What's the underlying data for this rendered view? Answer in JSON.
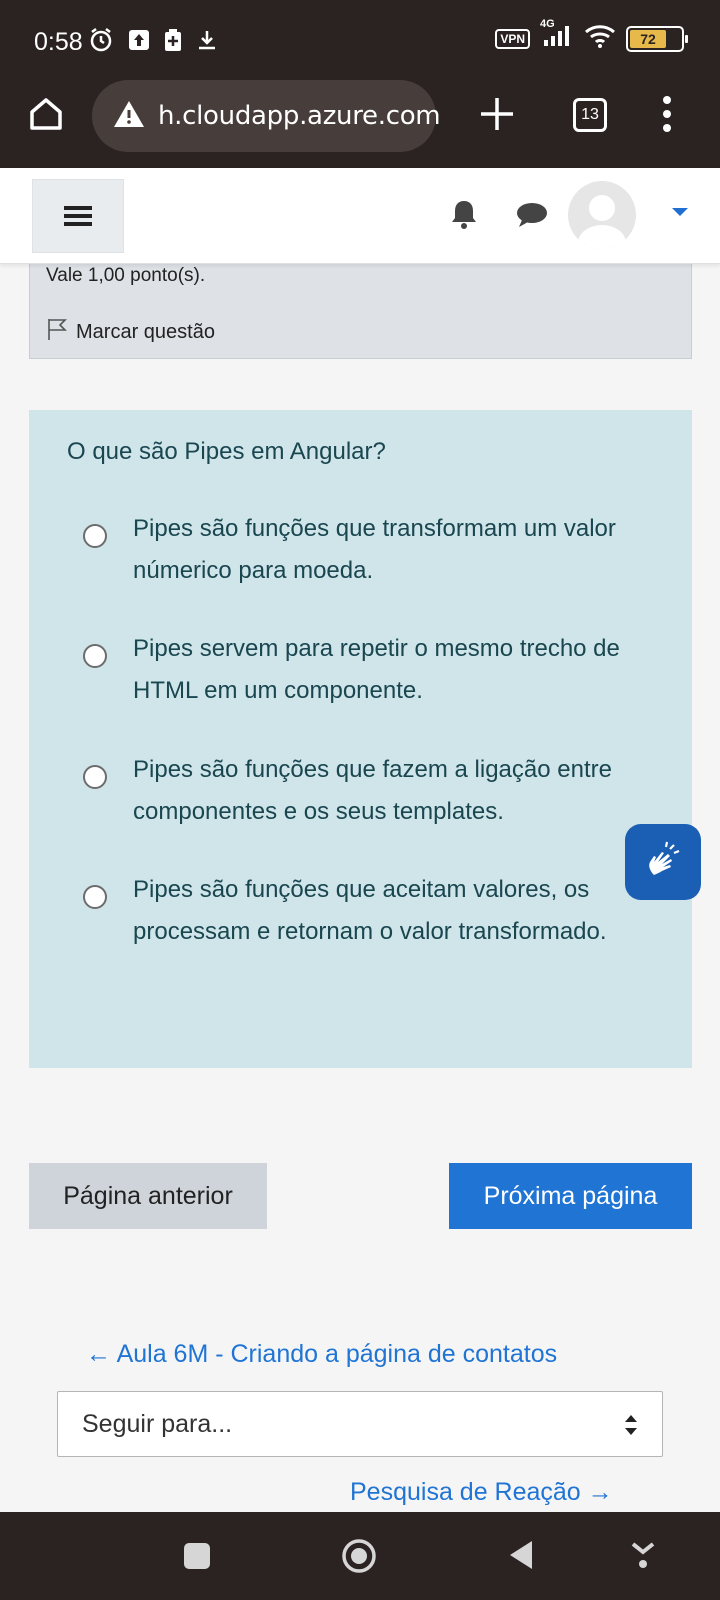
{
  "status_bar": {
    "time": "0:58",
    "vpn": "VPN",
    "network": "4G",
    "battery_level": "72"
  },
  "browser": {
    "url": "h.cloudapp.azure.com",
    "tab_count": "13"
  },
  "question_info": {
    "points": "Vale 1,00 ponto(s).",
    "flag_label": "Marcar questão"
  },
  "question": {
    "text": "O que são Pipes em Angular?",
    "options": [
      "Pipes são funções que transformam um valor númerico para moeda.",
      "Pipes servem para repetir o mesmo trecho de HTML em um componente.",
      "Pipes são funções que fazem a ligação entre componentes e os seus templates.",
      "Pipes são funções que aceitam valores, os processam e retornam o valor transformado."
    ]
  },
  "navigation": {
    "prev_button": "Página anterior",
    "next_button": "Próxima página",
    "prev_activity": "← Aula 6M - Criando a página de contatos",
    "jump_placeholder": "Seguir para...",
    "next_activity": "Pesquisa de Reação →"
  },
  "colors": {
    "primary": "#1f74d4",
    "question_bg": "#cfe5ea",
    "system_bar": "#2b2322"
  }
}
